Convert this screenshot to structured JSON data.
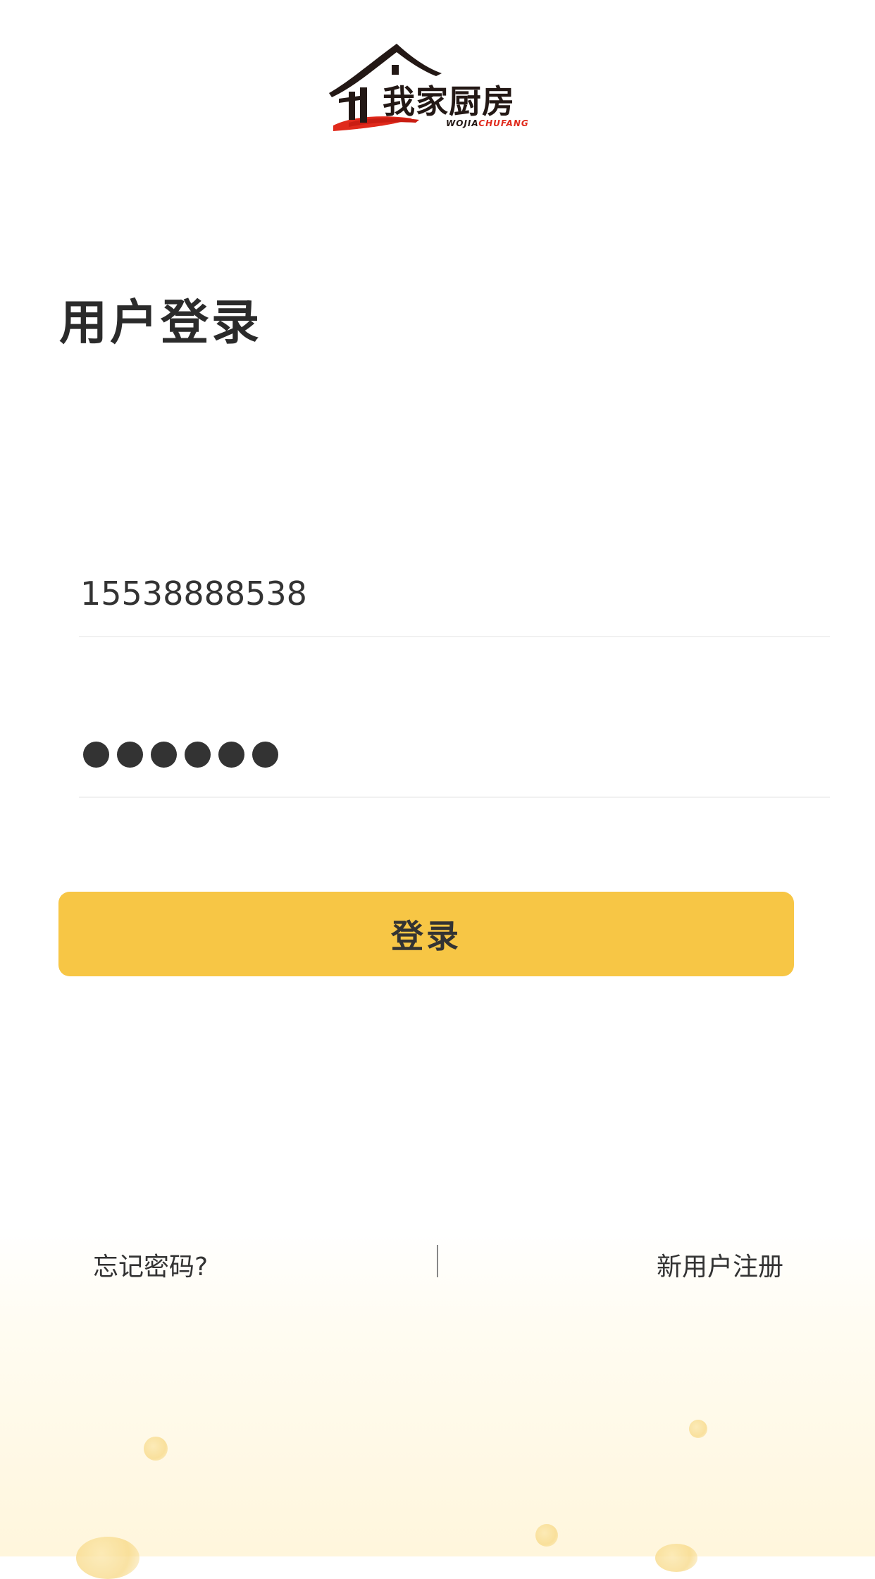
{
  "logo": {
    "name": "我家厨房",
    "sub_part1": "WOJIA",
    "sub_part2": "CHUFANG"
  },
  "page_title": "用户登录",
  "form": {
    "phone_value": "15538888538",
    "password_mask_count": 6,
    "login_label": "登录"
  },
  "links": {
    "forgot": "忘记密码?",
    "register": "新用户注册"
  },
  "colors": {
    "accent": "#f7c645",
    "text": "#333333",
    "logo_red": "#e02a1c"
  }
}
